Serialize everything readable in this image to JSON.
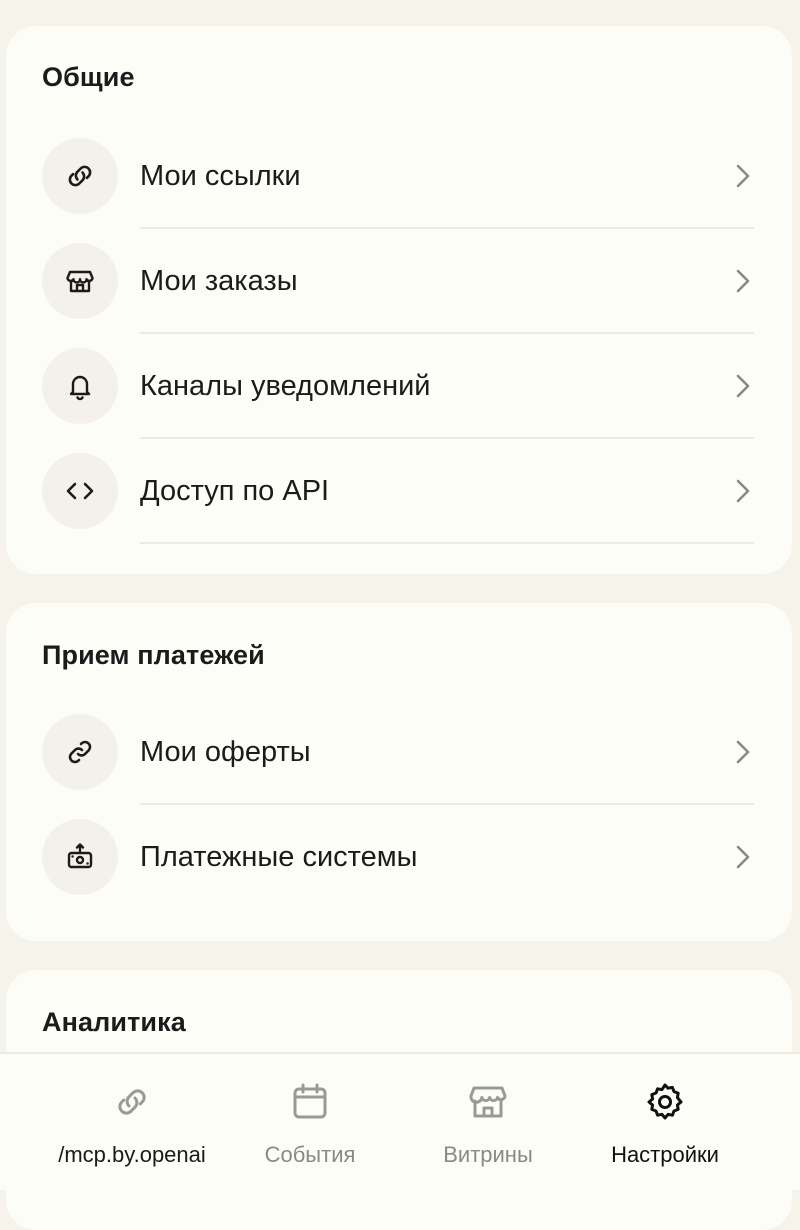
{
  "sections": {
    "general": {
      "title": "Общие",
      "items": [
        {
          "label": "Мои ссылки",
          "icon": "link-icon"
        },
        {
          "label": "Мои заказы",
          "icon": "storefront-icon"
        },
        {
          "label": "Каналы уведомлений",
          "icon": "bell-icon"
        },
        {
          "label": "Доступ по API",
          "icon": "code-icon"
        }
      ]
    },
    "payments": {
      "title": "Прием платежей",
      "items": [
        {
          "label": "Мои оферты",
          "icon": "link-alt-icon"
        },
        {
          "label": "Платежные системы",
          "icon": "payment-icon"
        }
      ]
    },
    "analytics": {
      "title": "Аналитика"
    }
  },
  "tabbar": {
    "tabs": [
      {
        "label": "/mcp.by.openai",
        "icon": "link-icon",
        "state": "inactive"
      },
      {
        "label": "События",
        "icon": "calendar-icon",
        "state": "inactive"
      },
      {
        "label": "Витрины",
        "icon": "storefront-icon",
        "state": "inactive"
      },
      {
        "label": "Настройки",
        "icon": "gear-icon",
        "state": "active"
      }
    ]
  },
  "colors": {
    "background": "#f5f3ea",
    "card": "#fdfdf8",
    "icon_circle": "#f3f1e9",
    "divider": "#ecebdf",
    "text": "#1b1b1b",
    "inactive_tab": "#8a8a85"
  }
}
